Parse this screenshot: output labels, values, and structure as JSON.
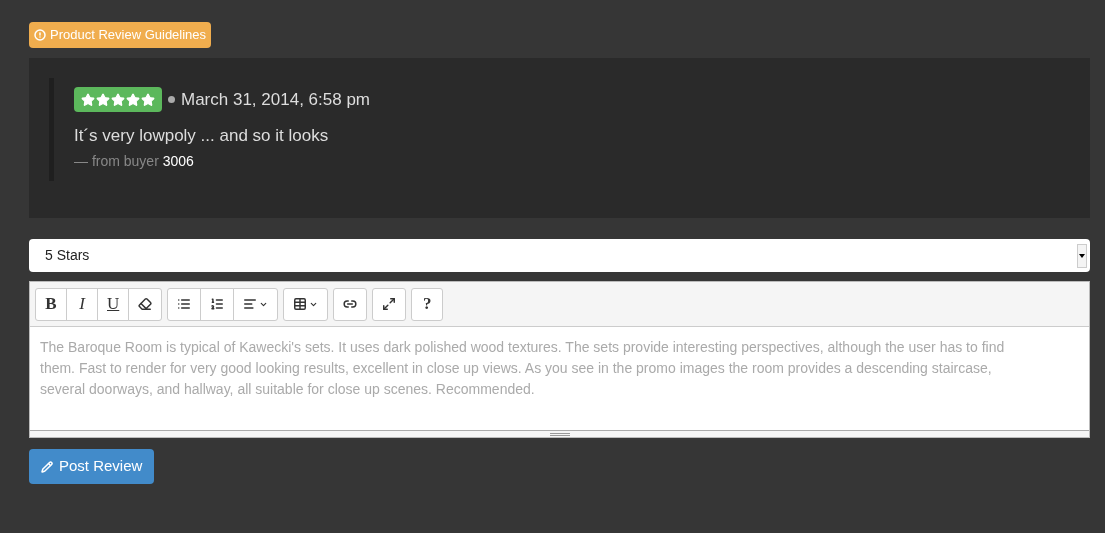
{
  "guidelines_label": "Product Review Guidelines",
  "review": {
    "stars": 5,
    "date": "March 31, 2014, 6:58 pm",
    "text": "It´s very lowpoly ... and so it looks",
    "byline": "— from buyer",
    "buyer": "3006"
  },
  "rating_select": {
    "value": "5 Stars"
  },
  "toolbar": [
    [
      {
        "kind": "text",
        "label": "B"
      },
      {
        "kind": "text",
        "label": "I"
      },
      {
        "kind": "text",
        "label": "U"
      },
      {
        "kind": "eraser"
      }
    ],
    [
      {
        "kind": "bullets"
      },
      {
        "kind": "numbers"
      },
      {
        "kind": "align"
      }
    ],
    [
      {
        "kind": "table"
      }
    ],
    [
      {
        "kind": "link"
      }
    ],
    [
      {
        "kind": "fullscreen"
      }
    ],
    [
      {
        "kind": "text",
        "label": "?"
      }
    ]
  ],
  "editor": {
    "value": "The Baroque Room is typical of Kawecki's sets. It uses dark polished wood textures. The sets provide interesting perspectives, although the user has to find them. Fast to render for very good looking results, excellent in close up views. As you see in the promo images the room provides a descending staircase, several doorways, and hallway, all suitable for close up scenes. Recommended."
  },
  "post_button": "Post Review"
}
